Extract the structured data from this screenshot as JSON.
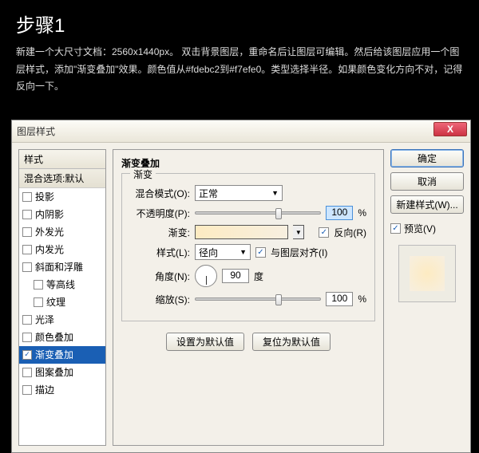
{
  "header": {
    "title": "步骤1",
    "desc": "新建一个大尺寸文档：2560x1440px。\n双击背景图层，重命名后让图层可编辑。然后给该图层应用一个图层样式，添加\"渐变叠加\"效果。颜色值从#fdebc2到#f7efe0。类型选择半径。如果颜色变化方向不对，记得反向一下。"
  },
  "dialog": {
    "title": "图层样式",
    "styles_header": "样式",
    "blend_options": "混合选项:默认",
    "items": [
      {
        "label": "投影",
        "checked": false
      },
      {
        "label": "内阴影",
        "checked": false
      },
      {
        "label": "外发光",
        "checked": false
      },
      {
        "label": "内发光",
        "checked": false
      },
      {
        "label": "斜面和浮雕",
        "checked": false
      },
      {
        "label": "等高线",
        "checked": false,
        "indent": true
      },
      {
        "label": "纹理",
        "checked": false,
        "indent": true
      },
      {
        "label": "光泽",
        "checked": false
      },
      {
        "label": "颜色叠加",
        "checked": false
      },
      {
        "label": "渐变叠加",
        "checked": true,
        "selected": true
      },
      {
        "label": "图案叠加",
        "checked": false
      },
      {
        "label": "描边",
        "checked": false
      }
    ],
    "group_title": "渐变叠加",
    "fieldset_legend": "渐变",
    "labels": {
      "blend_mode": "混合模式(O):",
      "opacity": "不透明度(P):",
      "gradient": "渐变:",
      "style": "样式(L):",
      "angle": "角度(N):",
      "scale": "缩放(S):",
      "reverse": "反向(R)",
      "align": "与图层对齐(I)",
      "degree": "度",
      "percent": "%"
    },
    "values": {
      "blend_mode": "正常",
      "opacity": "100",
      "style": "径向",
      "angle": "90",
      "scale": "100",
      "reverse_checked": true,
      "align_checked": true
    },
    "buttons": {
      "set_default": "设置为默认值",
      "reset_default": "复位为默认值"
    },
    "right": {
      "ok": "确定",
      "cancel": "取消",
      "new_style": "新建样式(W)...",
      "preview": "预览(V)"
    }
  }
}
